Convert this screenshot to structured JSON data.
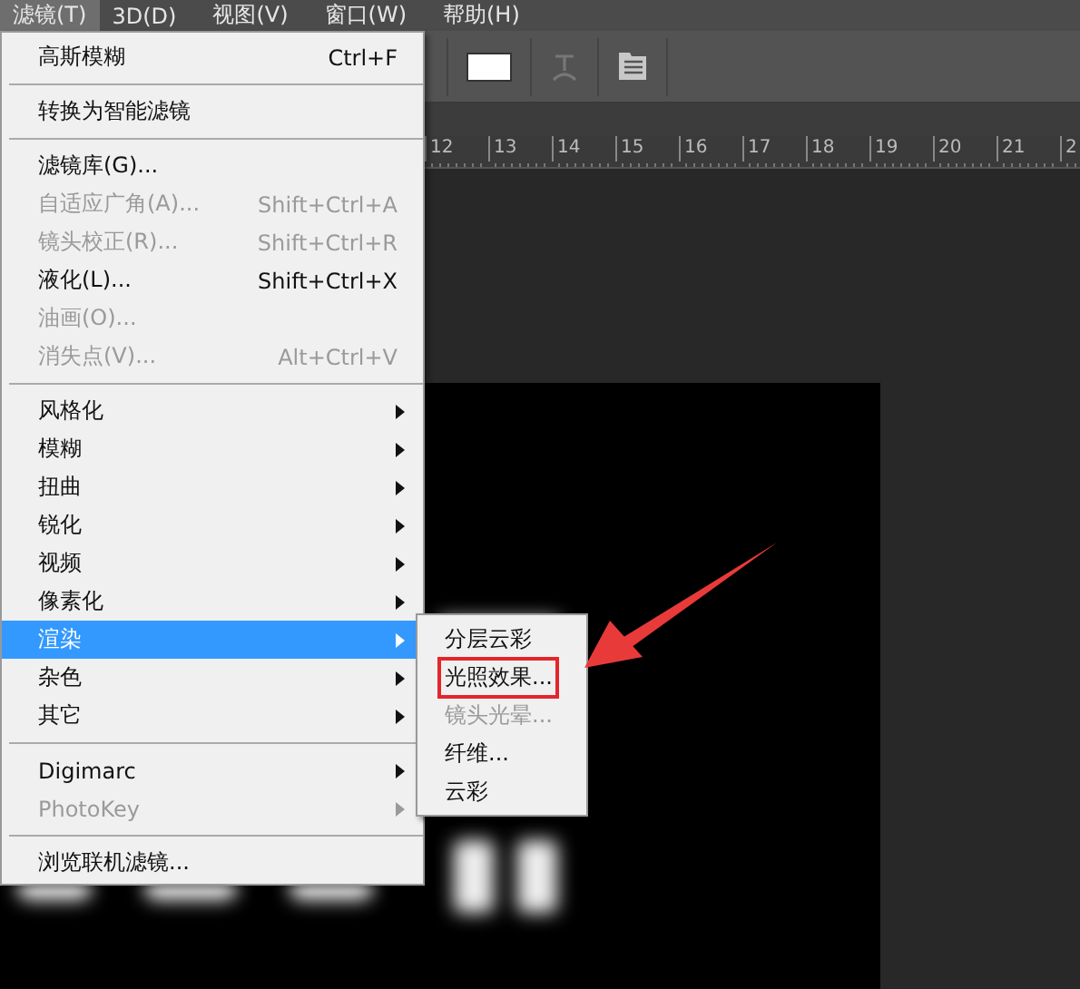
{
  "menubar": [
    {
      "label": "滤镜(T)",
      "selected": true
    },
    {
      "label": "3D(D)",
      "selected": false
    },
    {
      "label": "视图(V)",
      "selected": false
    },
    {
      "label": "窗口(W)",
      "selected": false
    },
    {
      "label": "帮助(H)",
      "selected": false
    }
  ],
  "ruler": [
    "12",
    "13",
    "14",
    "15",
    "16",
    "17",
    "18",
    "19",
    "20",
    "21",
    "2"
  ],
  "menu": {
    "items": [
      {
        "kind": "item",
        "label": "高斯模糊",
        "shortcut": "Ctrl+F",
        "disabled": false,
        "submenu": false,
        "selected": false
      },
      {
        "kind": "separator"
      },
      {
        "kind": "item",
        "label": "转换为智能滤镜",
        "disabled": false,
        "submenu": false,
        "selected": false
      },
      {
        "kind": "separator"
      },
      {
        "kind": "item",
        "label": "滤镜库(G)...",
        "disabled": false,
        "submenu": false,
        "selected": false
      },
      {
        "kind": "item",
        "label": "自适应广角(A)...",
        "shortcut": "Shift+Ctrl+A",
        "disabled": true,
        "submenu": false,
        "selected": false
      },
      {
        "kind": "item",
        "label": "镜头校正(R)...",
        "shortcut": "Shift+Ctrl+R",
        "disabled": true,
        "submenu": false,
        "selected": false
      },
      {
        "kind": "item",
        "label": "液化(L)...",
        "shortcut": "Shift+Ctrl+X",
        "disabled": false,
        "submenu": false,
        "selected": false
      },
      {
        "kind": "item",
        "label": "油画(O)...",
        "disabled": true,
        "submenu": false,
        "selected": false
      },
      {
        "kind": "item",
        "label": "消失点(V)...",
        "shortcut": "Alt+Ctrl+V",
        "disabled": true,
        "submenu": false,
        "selected": false
      },
      {
        "kind": "separator"
      },
      {
        "kind": "item",
        "label": "风格化",
        "disabled": false,
        "submenu": true,
        "selected": false
      },
      {
        "kind": "item",
        "label": "模糊",
        "disabled": false,
        "submenu": true,
        "selected": false
      },
      {
        "kind": "item",
        "label": "扭曲",
        "disabled": false,
        "submenu": true,
        "selected": false
      },
      {
        "kind": "item",
        "label": "锐化",
        "disabled": false,
        "submenu": true,
        "selected": false
      },
      {
        "kind": "item",
        "label": "视频",
        "disabled": false,
        "submenu": true,
        "selected": false
      },
      {
        "kind": "item",
        "label": "像素化",
        "disabled": false,
        "submenu": true,
        "selected": false
      },
      {
        "kind": "item",
        "label": "渲染",
        "disabled": false,
        "submenu": true,
        "selected": true
      },
      {
        "kind": "item",
        "label": "杂色",
        "disabled": false,
        "submenu": true,
        "selected": false
      },
      {
        "kind": "item",
        "label": "其它",
        "disabled": false,
        "submenu": true,
        "selected": false
      },
      {
        "kind": "separator"
      },
      {
        "kind": "item",
        "label": "Digimarc",
        "disabled": false,
        "submenu": true,
        "selected": false
      },
      {
        "kind": "item",
        "label": "PhotoKey",
        "disabled": true,
        "submenu": true,
        "selected": false
      },
      {
        "kind": "separator"
      },
      {
        "kind": "item",
        "label": "浏览联机滤镜...",
        "disabled": false,
        "submenu": false,
        "selected": false
      }
    ]
  },
  "submenu": {
    "items": [
      {
        "label": "分层云彩",
        "disabled": false,
        "annotated": false
      },
      {
        "label": "光照效果...",
        "disabled": false,
        "annotated": true
      },
      {
        "label": "镜头光晕...",
        "disabled": true,
        "annotated": false
      },
      {
        "label": "纤维...",
        "disabled": false,
        "annotated": false
      },
      {
        "label": "云彩",
        "disabled": false,
        "annotated": false
      }
    ]
  }
}
